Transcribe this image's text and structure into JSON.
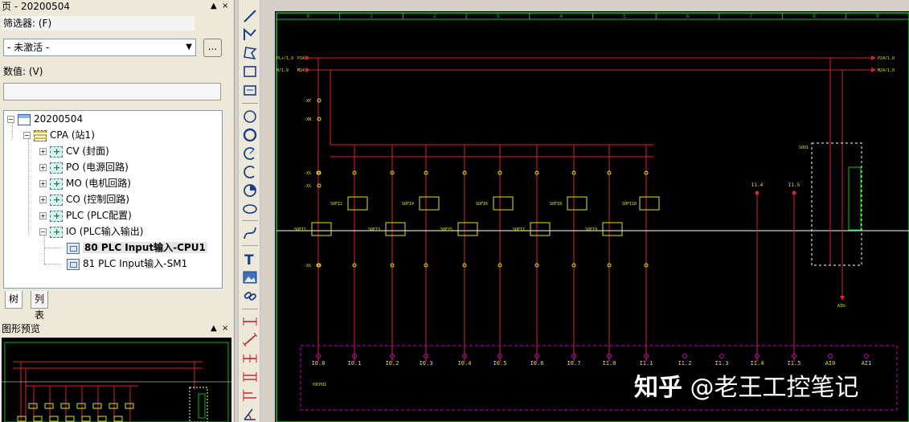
{
  "page_panel": {
    "title": "页 - 20200504",
    "pin": "▲",
    "close": "×"
  },
  "filter": {
    "label": "筛选器: (F)",
    "selected": "- 未激活 -",
    "more_label": "..."
  },
  "value": {
    "label": "数值: (V)",
    "input_value": ""
  },
  "tree": {
    "root": "20200504",
    "station": "CPA (站1)",
    "groups": [
      "CV (封面)",
      "PO (电源回路)",
      "MO (电机回路)",
      "CO (控制回路)",
      "PLC (PLC配置)",
      "IO (PLC输入输出)"
    ],
    "pages": [
      "80 PLC Input输入-CPU1",
      "81 PLC Input输入-SM1"
    ],
    "selected_index": 0
  },
  "tabs": [
    "树",
    "列表"
  ],
  "preview_panel": {
    "title": "图形预览",
    "pin": "▲",
    "close": "×"
  },
  "toolbar": {
    "tools": [
      "line-icon",
      "polyline-icon",
      "polygon-icon",
      "rectangle-icon",
      "rectangle-rounded-icon",
      "circle-icon",
      "circle-thick-icon",
      "arc-icon",
      "arc-open-icon",
      "sector-icon",
      "ellipse-icon",
      "spline-icon",
      "text-icon",
      "image-icon",
      "hyperlink-icon",
      "dimension-linear-icon",
      "dimension-aligned-icon",
      "dimension-chain-icon",
      "dimension-increment-icon",
      "dimension-baseline-icon",
      "dimension-angle-icon"
    ]
  },
  "schematic": {
    "columns": [
      "0",
      "1",
      "2",
      "3",
      "4",
      "5",
      "6",
      "7",
      "8",
      "9"
    ],
    "rails": [
      {
        "left": "PL+/1.9",
        "tag": "P24",
        "right": "P24/1.0"
      },
      {
        "left": "M/1.9",
        "tag": "M24",
        "right": "M24/1.0"
      }
    ],
    "side_tags": [
      "-XP",
      "-XN",
      "-XS",
      "-XS",
      "-XS"
    ],
    "switches_top": [
      "SOFI2",
      "SOFI4",
      "SOFI6",
      "SOFI8",
      "SOFI10"
    ],
    "switches_bottom": [
      "SOFI1",
      "SOFI3",
      "SOFI5",
      "SOFI7",
      "SOFI9"
    ],
    "io_labels": [
      "I0.0",
      "I0.1",
      "I0.2",
      "I0.3",
      "I0.4",
      "I0.5",
      "I0.6",
      "I0.7",
      "I1.0",
      "I1.1",
      "I1.2",
      "I1.3",
      "I1.4",
      "I1.5",
      "AI0",
      "AI1"
    ],
    "spare_labels": [
      "I1.4",
      "I1.5"
    ],
    "analog_block": "SOU1",
    "analog_out": "AI0-",
    "plc_block": "?OCPU1",
    "colors": {
      "background": "#000000",
      "wire": "#e0202a",
      "green": "#00d000",
      "yellow": "#e6e600",
      "magenta": "#c000c0",
      "rail": "#e0202a"
    }
  },
  "watermark": {
    "logo": "知乎",
    "text": "@老王工控笔记"
  }
}
